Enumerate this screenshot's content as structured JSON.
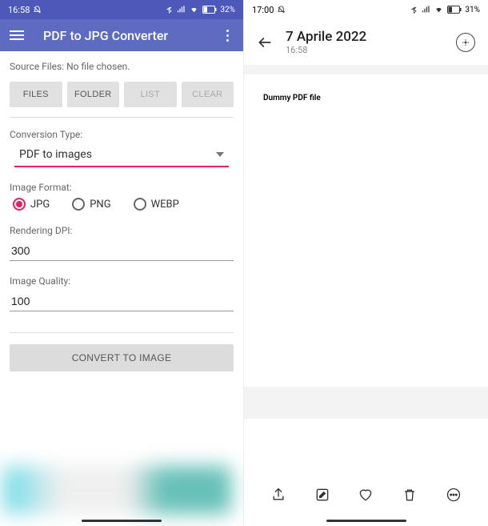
{
  "left": {
    "status": {
      "time": "16:58",
      "battery": "32%"
    },
    "appbar": {
      "title": "PDF to JPG Converter"
    },
    "source_label": "Source Files:",
    "source_value": "No file chosen.",
    "buttons": {
      "files": "FILES",
      "folder": "FOLDER",
      "list": "LIST",
      "clear": "CLEAR"
    },
    "conversion_label": "Conversion Type:",
    "conversion_value": "PDF to images",
    "image_format_label": "Image Format:",
    "formats": {
      "jpg": "JPG",
      "png": "PNG",
      "webp": "WEBP"
    },
    "dpi_label": "Rendering DPI:",
    "dpi_value": "300",
    "quality_label": "Image Quality:",
    "quality_value": "100",
    "convert_label": "CONVERT TO IMAGE"
  },
  "right": {
    "status": {
      "time": "17:00",
      "battery": "31%"
    },
    "date": "7 Aprile 2022",
    "time": "16:58",
    "doc_content": "Dummy PDF file"
  }
}
